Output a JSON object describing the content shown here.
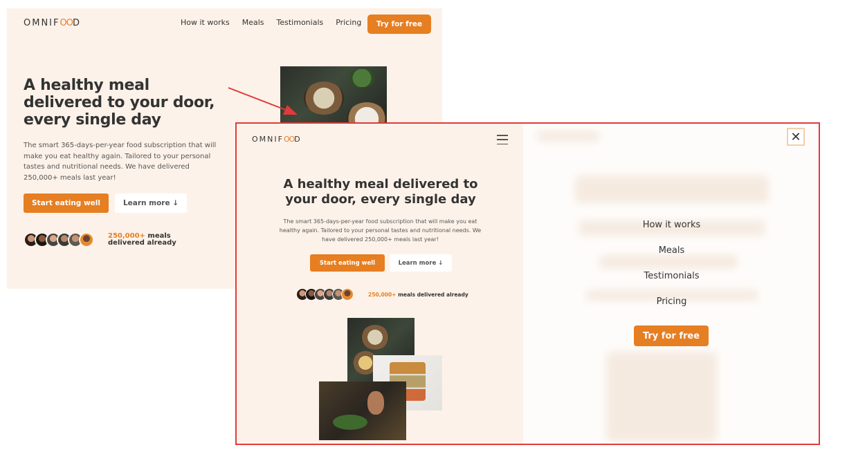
{
  "brand": {
    "logo_pre": "OMNIF",
    "logo_oo": "OO",
    "logo_post": "D",
    "accent": "#e67e22",
    "bg": "#fdf2e9"
  },
  "desktop": {
    "nav": [
      "How it works",
      "Meals",
      "Testimonials",
      "Pricing"
    ],
    "cta": "Try for free",
    "heading": "A healthy meal delivered to your door, every single day",
    "description": "The smart 365-days-per-year food subscription that will make you eat healthy again. Tailored to your personal tastes and nutritional needs. We have delivered 250,000+ meals last year!",
    "primary_button": "Start eating well",
    "secondary_button": "Learn more ↓",
    "served_count": "250,000+",
    "served_text": " meals delivered already"
  },
  "mobile": {
    "heading": "A healthy meal delivered to your door, every single day",
    "description": "The smart 365-days-per-year food subscription that will make you eat healthy again. Tailored to your personal tastes and nutritional needs. We have delivered 250,000+ meals last year!",
    "primary_button": "Start eating well",
    "secondary_button": "Learn more ↓",
    "served_count": "250,000+",
    "served_text": " meals delivered already",
    "menu": [
      "How it works",
      "Meals",
      "Testimonials",
      "Pricing"
    ],
    "menu_cta": "Try for free",
    "close_icon": "close-icon",
    "hamburger_icon": "hamburger-menu-icon"
  },
  "annotation": {
    "arrow_color": "#e03a3a",
    "highlight_border": "#e03a3a"
  }
}
